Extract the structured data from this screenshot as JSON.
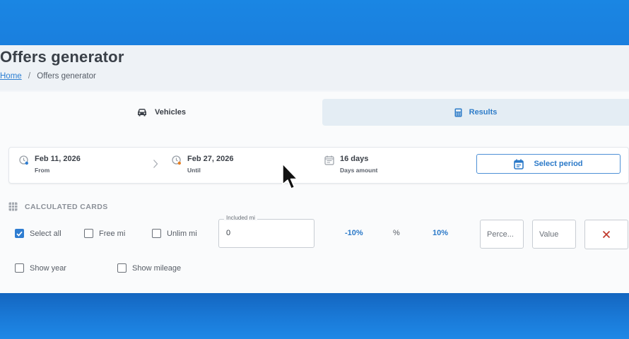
{
  "page": {
    "title": "Offers generator",
    "breadcrumb": {
      "home": "Home",
      "separator": "/",
      "current": "Offers generator"
    }
  },
  "tabs": [
    {
      "label": "Vehicles",
      "icon": "car-icon",
      "active": true
    },
    {
      "label": "Results",
      "icon": "calculator-icon",
      "active": false
    }
  ],
  "period": {
    "from": {
      "value": "Feb 11, 2026",
      "label": "From"
    },
    "until": {
      "value": "Feb 27, 2026",
      "label": "Until"
    },
    "days": {
      "value": "16 days",
      "label": "Days amount"
    },
    "select_button": "Select period"
  },
  "calculated_cards": {
    "title": "CALCULATED CARDS",
    "select_all": {
      "label": "Select all",
      "checked": true
    },
    "free_mi": {
      "label": "Free mi",
      "checked": false
    },
    "unlim_mi": {
      "label": "Unlim mi",
      "checked": false
    },
    "included_mi": {
      "label": "Included mi",
      "value": "0"
    },
    "minus_pct": "-10%",
    "pct_sign": "%",
    "plus_pct": "10%",
    "percent_placeholder": "Perce...",
    "value_placeholder": "Value",
    "show_year": {
      "label": "Show year",
      "checked": false
    },
    "show_mileage": {
      "label": "Show mileage",
      "checked": false
    }
  },
  "colors": {
    "accent": "#2b79c8",
    "background_blue": "#1a7fde",
    "clear_icon": "#c0392b"
  }
}
